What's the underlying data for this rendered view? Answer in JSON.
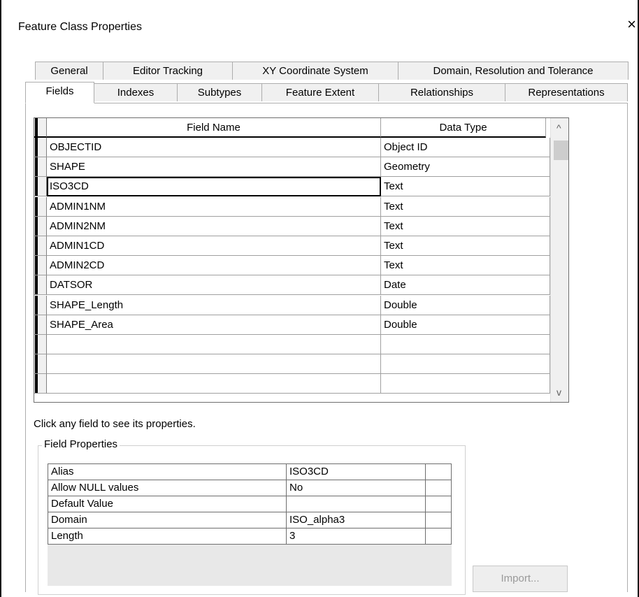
{
  "dialog": {
    "title": "Feature Class Properties",
    "close_glyph": "×"
  },
  "tabs_row1": [
    "General",
    "Editor Tracking",
    "XY Coordinate System",
    "Domain, Resolution and Tolerance"
  ],
  "tabs_row2": [
    "Fields",
    "Indexes",
    "Subtypes",
    "Feature Extent",
    "Relationships",
    "Representations"
  ],
  "selected_tab": "Fields",
  "grid": {
    "headers": {
      "field_name": "Field Name",
      "data_type": "Data Type"
    },
    "rows": [
      {
        "name": "OBJECTID",
        "type": "Object ID"
      },
      {
        "name": "SHAPE",
        "type": "Geometry"
      },
      {
        "name": "ISO3CD",
        "type": "Text"
      },
      {
        "name": "ADMIN1NM",
        "type": "Text"
      },
      {
        "name": "ADMIN2NM",
        "type": "Text"
      },
      {
        "name": "ADMIN1CD",
        "type": "Text"
      },
      {
        "name": "ADMIN2CD",
        "type": "Text"
      },
      {
        "name": "DATSOR",
        "type": "Date"
      },
      {
        "name": "SHAPE_Length",
        "type": "Double"
      },
      {
        "name": "SHAPE_Area",
        "type": "Double"
      },
      {
        "name": "",
        "type": ""
      },
      {
        "name": "",
        "type": ""
      },
      {
        "name": "",
        "type": ""
      }
    ],
    "focused_row": 2,
    "scroll_up_glyph": "^",
    "scroll_down_glyph": "v"
  },
  "hint": "Click any field to see its properties.",
  "field_properties": {
    "legend": "Field Properties",
    "rows": [
      {
        "label": "Alias",
        "value": "ISO3CD"
      },
      {
        "label": "Allow NULL values",
        "value": "No"
      },
      {
        "label": "Default Value",
        "value": ""
      },
      {
        "label": "Domain",
        "value": "ISO_alpha3"
      },
      {
        "label": "Length",
        "value": "3"
      }
    ]
  },
  "import_button": "Import..."
}
